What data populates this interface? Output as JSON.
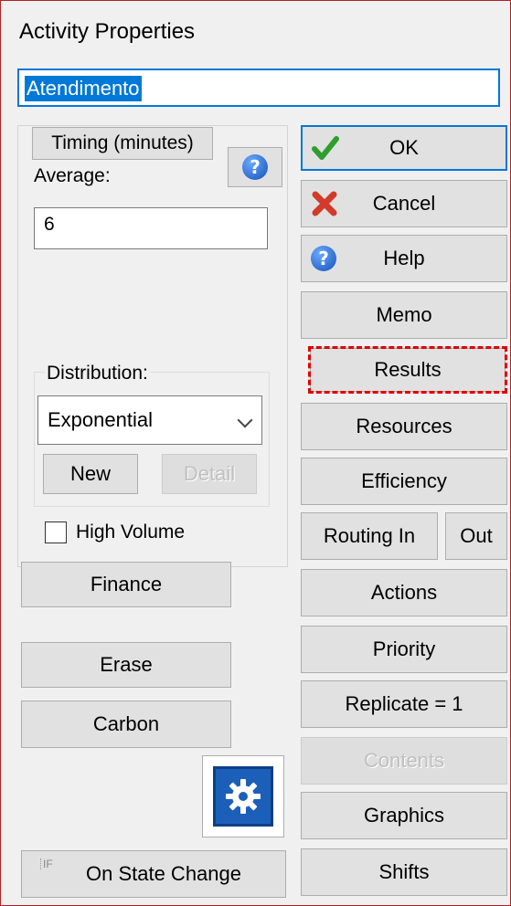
{
  "dialog": {
    "title": "Activity Properties",
    "name_value": "Atendimento"
  },
  "timing": {
    "tab_label": "Timing (minutes)",
    "average_label": "Average:",
    "average_value": "6",
    "distribution_label": "Distribution:",
    "distribution_value": "Exponential",
    "new_label": "New",
    "detail_label": "Detail",
    "high_volume_label": "High Volume",
    "high_volume_checked": false
  },
  "left_buttons": {
    "finance": "Finance",
    "erase": "Erase",
    "carbon": "Carbon",
    "on_state_change": "On State Change"
  },
  "right_buttons": {
    "ok": "OK",
    "cancel": "Cancel",
    "help": "Help",
    "memo": "Memo",
    "results": "Results",
    "resources": "Resources",
    "efficiency": "Efficiency",
    "routing_in": "Routing In",
    "out": "Out",
    "actions": "Actions",
    "priority": "Priority",
    "replicate": "Replicate = 1",
    "contents": "Contents",
    "graphics": "Graphics",
    "shifts": "Shifts"
  },
  "colors": {
    "accent": "#0078d7",
    "highlight": "#e00000",
    "window_border": "#b22222"
  },
  "icons": {
    "ok": "check-icon",
    "cancel": "x-icon",
    "help": "question-icon",
    "gear": "gear-icon"
  }
}
